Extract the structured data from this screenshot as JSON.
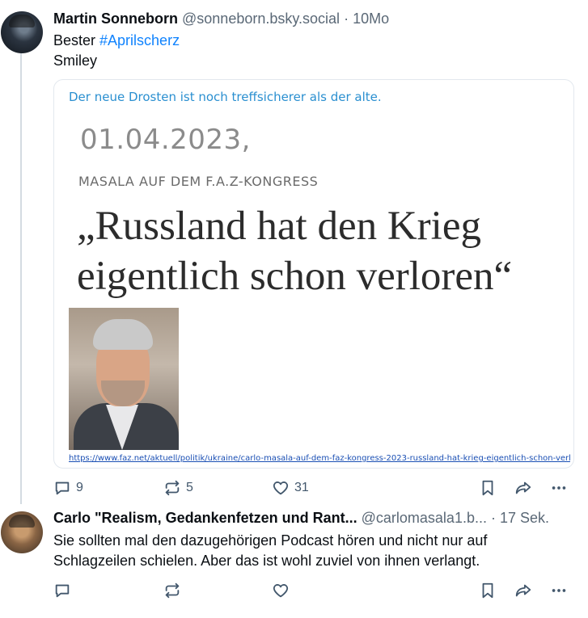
{
  "post1": {
    "author_name": "Martin Sonneborn",
    "handle": "@sonneborn.bsky.social",
    "separator": "·",
    "time": "10Mo",
    "text_prefix": "Bester ",
    "hashtag": "#Aprilscherz",
    "text_line2": "Smiley",
    "embed": {
      "caption": "Der neue Drosten ist noch treffsicherer als der alte.",
      "date": "01.04.2023,",
      "kicker": "MASALA AUF DEM F.A.Z-KONGRESS",
      "headline_line1": "„Russland hat den Krieg",
      "headline_line2": "eigentlich schon verloren“",
      "link": "https://www.faz.net/aktuell/politik/ukraine/carlo-masala-auf-dem-faz-kongress-2023-russland-hat-krieg-eigentlich-schon-verloren-18793799.html"
    },
    "actions": {
      "reply_count": "9",
      "repost_count": "5",
      "like_count": "31"
    }
  },
  "post2": {
    "author_name": "Carlo \"Realism, Gedankenfetzen und Rant...",
    "handle": "@carlomasala1.b...",
    "separator": "·",
    "time": "17 Sek.",
    "text_line1": "Sie sollten mal den dazugehörigen Podcast hören und nicht nur auf",
    "text_line2": "Schlagzeilen schielen. Aber das ist wohl zuviel von ihnen verlangt.",
    "actions": {
      "reply_count": "",
      "repost_count": "",
      "like_count": ""
    }
  },
  "icons": {
    "reply": "speech-bubble-icon",
    "repost": "repost-arrows-icon",
    "like": "heart-icon",
    "save": "bookmark-icon",
    "share": "share-arrow-icon",
    "more": "ellipsis-icon"
  },
  "colors": {
    "link_blue": "#1083fe",
    "muted": "#5a6876",
    "icon": "#42576c"
  }
}
